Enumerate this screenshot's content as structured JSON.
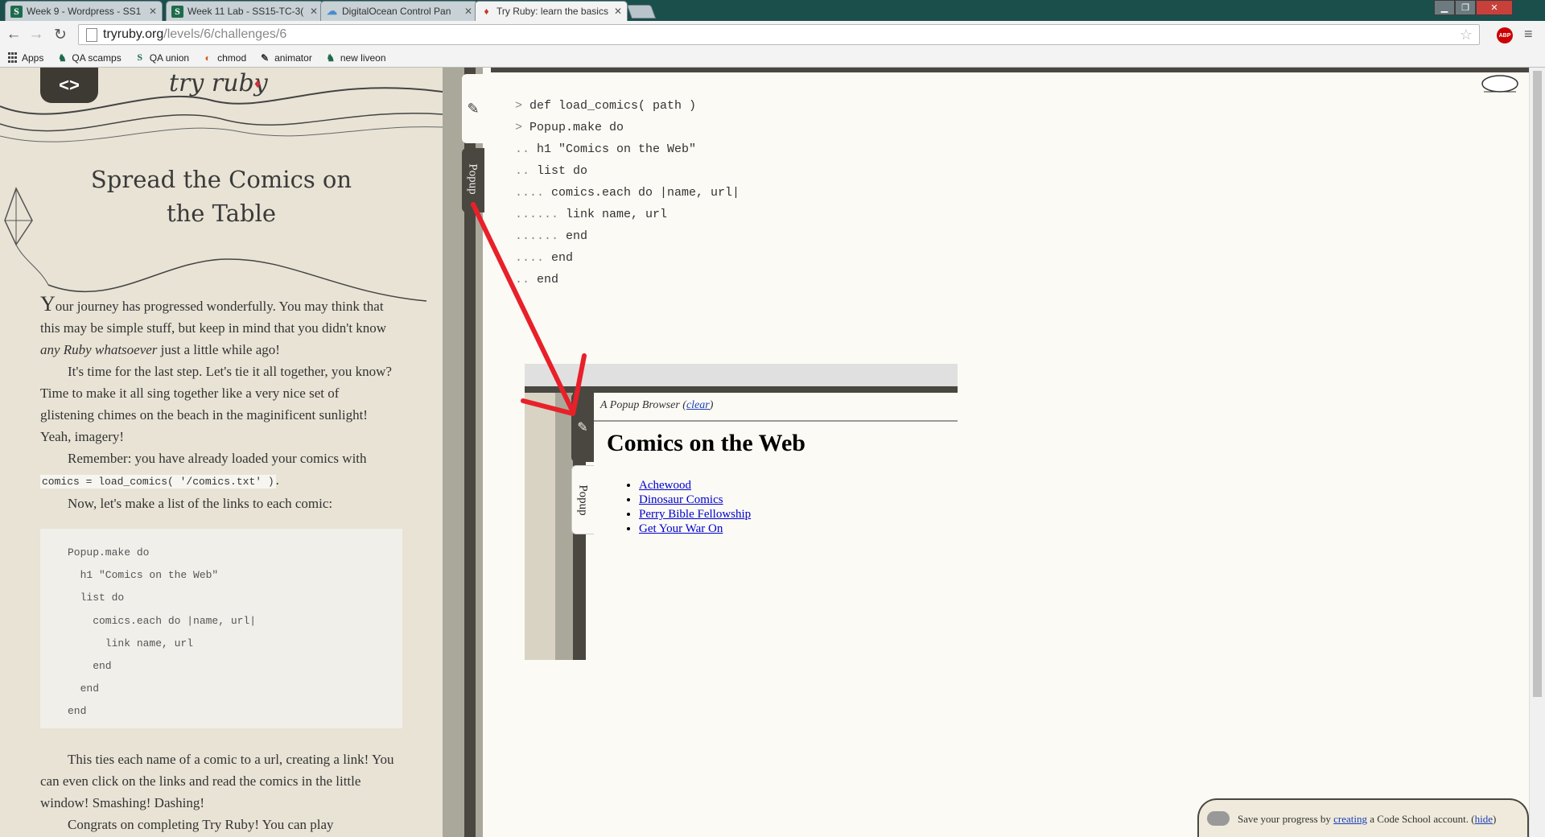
{
  "browser": {
    "tabs": [
      {
        "title": "Week 9 - Wordpress - SS1",
        "favicon": "s-icon",
        "active": false
      },
      {
        "title": "Week 11 Lab - SS15-TC-3(",
        "favicon": "s-icon",
        "active": false
      },
      {
        "title": "DigitalOcean Control Pan",
        "favicon": "cloud-icon",
        "active": false
      },
      {
        "title": "Try Ruby: learn the basics",
        "favicon": "ruby-icon",
        "active": true
      }
    ],
    "tab_close": "✕",
    "url_host": "tryruby.org",
    "url_path": "/levels/6/challenges/6",
    "bookmarks": [
      {
        "label": "Apps"
      },
      {
        "label": "QA scamps"
      },
      {
        "label": "QA union"
      },
      {
        "label": "chmod"
      },
      {
        "label": "animator"
      },
      {
        "label": "new liveon"
      }
    ],
    "abp_label": "ABP"
  },
  "sidebar": {
    "logo_text": "try ruby",
    "title": "Spread the Comics on the Table",
    "para1_drop": "Y",
    "para1_rest": "our journey has progressed wonderfully. You may think that this may be simple stuff, but keep in mind that you didn't know ",
    "para1_em": "any Ruby whatsoever",
    "para1_end": " just a little while ago!",
    "para2": "It's time for the last step. Let's tie it all together, you know? Time to make it all sing together like a very nice set of glistening chimes on the beach in the maginificent sunlight! Yeah, imagery!",
    "para3_start": "Remember: you have already loaded your comics with ",
    "para3_code": "comics = load_comics( '/comics.txt' )",
    "para3_end": ".",
    "para4": "Now, let's make a list of the links to each comic:",
    "code": "Popup.make do\n  h1 \"Comics on the Web\"\n  list do\n    comics.each do |name, url|\n      link name, url\n    end\n  end\nend",
    "para5": "This ties each name of a comic to a url, creating a link! You can even click on the links and read the comics in the little window! Smashing! Dashing!",
    "para6": "Congrats on completing Try Ruby! You can play"
  },
  "tabs": {
    "popup_label": "Popup"
  },
  "console": {
    "lines": [
      {
        "prompt": "> ",
        "code": "def load_comics( path )"
      },
      {
        "prompt": "> ",
        "code": "Popup.make do"
      },
      {
        "prompt": ".. ",
        "code": "h1 \"Comics on the Web\""
      },
      {
        "prompt": ".. ",
        "code": "list do"
      },
      {
        "prompt": ".... ",
        "code": "comics.each do |name, url|"
      },
      {
        "prompt": "...... ",
        "code": "link name, url"
      },
      {
        "prompt": "...... ",
        "code": "end"
      },
      {
        "prompt": ".... ",
        "code": "end"
      },
      {
        "prompt": ".. ",
        "code": "end"
      }
    ]
  },
  "popup_browser": {
    "header": "A Popup Browser",
    "clear_label": "clear",
    "heading": "Comics on the Web",
    "links": [
      "Achewood",
      "Dinosaur Comics",
      "Perry Bible Fellowship",
      "Get Your War On"
    ],
    "tab_label": "Popup"
  },
  "savebar": {
    "text_start": "Save your progress by ",
    "link_creating": "creating",
    "text_mid": " a Code School account. (",
    "link_hide": "hide",
    "text_end": ")"
  },
  "colors": {
    "arrow": "#e8202a",
    "tab_bar": "#1b4f4c",
    "dark_strip": "#4a4740"
  }
}
